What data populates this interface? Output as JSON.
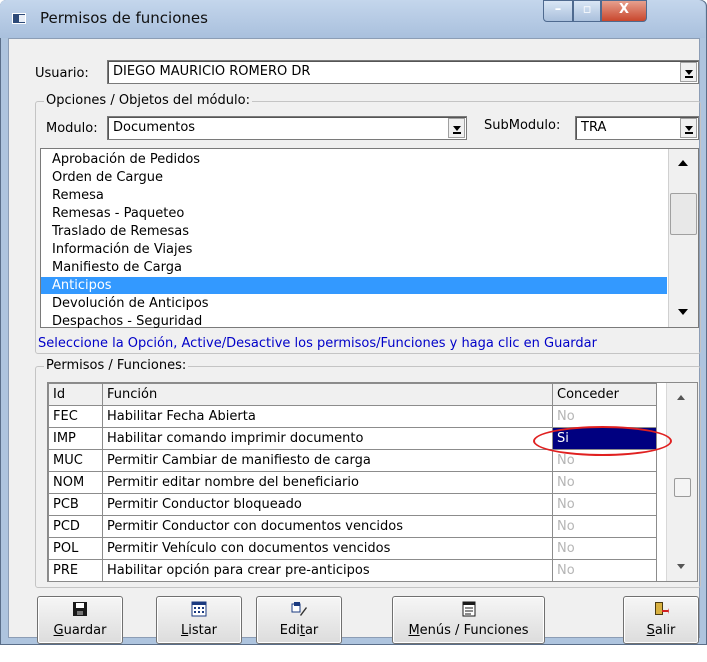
{
  "window": {
    "title": "Permisos de funciones",
    "caption_buttons": {
      "minimize": "–",
      "maximize": "▫",
      "close": "X"
    }
  },
  "usuario": {
    "label": "Usuario:",
    "value": "DIEGO MAURICIO ROMERO DR"
  },
  "opciones_group": {
    "title": "Opciones / Objetos del módulo:"
  },
  "modulo": {
    "label": "Modulo:",
    "value": "Documentos"
  },
  "submodulo": {
    "label": "SubModulo:",
    "value": "TRA"
  },
  "module_list": {
    "items": [
      "Aprobación de Pedidos",
      "Orden de Cargue",
      "Remesa",
      "Remesas - Paqueteo",
      "Traslado de Remesas",
      "Información de Viajes",
      "Manifiesto de Carga",
      "Anticipos",
      "Devolución de Anticipos",
      "Despachos - Seguridad"
    ],
    "selected": "Anticipos"
  },
  "hint": "Seleccione la Opción, Active/Desactive los permisos/Funciones y haga clic en Guardar",
  "permisos_group": {
    "title": "Permisos / Funciones:"
  },
  "grid": {
    "headers": {
      "id": "Id",
      "funcion": "Función",
      "conceder": "Conceder"
    },
    "rows": [
      {
        "id": "FEC",
        "funcion": "Habilitar Fecha Abierta",
        "conceder": "No"
      },
      {
        "id": "IMP",
        "funcion": "Habilitar comando imprimir documento",
        "conceder": "Si"
      },
      {
        "id": "MUC",
        "funcion": "Permitir Cambiar de manifiesto de carga",
        "conceder": "No"
      },
      {
        "id": "NOM",
        "funcion": "Permitir editar nombre del beneficiario",
        "conceder": "No"
      },
      {
        "id": "PCB",
        "funcion": "Permitir Conductor bloqueado",
        "conceder": "No"
      },
      {
        "id": "PCD",
        "funcion": "Permitir Conductor con documentos vencidos",
        "conceder": "No"
      },
      {
        "id": "POL",
        "funcion": "Permitir Vehículo con documentos vencidos",
        "conceder": "No"
      },
      {
        "id": "PRE",
        "funcion": "Habilitar opción para crear pre-anticipos",
        "conceder": "No"
      }
    ]
  },
  "toolbar": {
    "guardar": {
      "u": "G",
      "rest": "uardar",
      "icon": "floppy-disk-icon"
    },
    "listar": {
      "u": "L",
      "rest": "istar",
      "icon": "calendar-list-icon"
    },
    "editar": {
      "pre": "Edi",
      "u": "t",
      "rest": "ar",
      "icon": "edit-pencil-icon"
    },
    "menus": {
      "pre": "",
      "u": "M",
      "rest": "enús / Funciones",
      "icon": "document-menu-icon"
    },
    "salir": {
      "u": "S",
      "rest": "alir",
      "icon": "exit-door-icon"
    }
  },
  "colors": {
    "selection_blue": "#3399ff",
    "si_cell": "#000080",
    "hint_text": "#0000c8",
    "annotation_red": "#e02020"
  }
}
